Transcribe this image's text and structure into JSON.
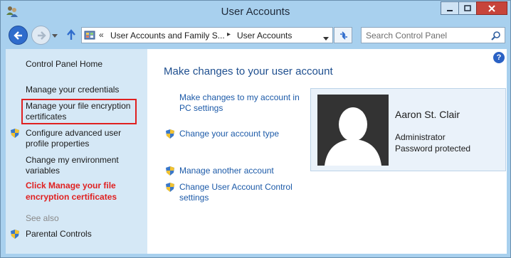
{
  "window": {
    "title": "User Accounts"
  },
  "navigation": {
    "breadcrumbs": [
      "User Accounts and Family S...",
      "User Accounts"
    ],
    "overflow_glyph": "«",
    "search_placeholder": "Search Control Panel"
  },
  "sidebar": {
    "home": "Control Panel Home",
    "links": [
      "Manage your credentials",
      "Manage your file encryption certificates",
      "Configure advanced user profile properties",
      "Change my environment variables"
    ],
    "see_also_label": "See also",
    "see_also_links": [
      "Parental Controls"
    ]
  },
  "annotation": {
    "callout": "Click Manage your file encryption certificates",
    "color": "#e02020"
  },
  "main": {
    "title": "Make changes to your user account",
    "tasks": [
      "Make changes to my account in PC settings",
      "Change your account type",
      "Manage another account",
      "Change User Account Control settings"
    ],
    "help_label": "?"
  },
  "account": {
    "name": "Aaron St. Clair",
    "type": "Administrator",
    "status": "Password protected"
  },
  "icons": [
    "app-users-icon",
    "minimize-icon",
    "maximize-icon",
    "close-icon",
    "back-arrow-icon",
    "forward-arrow-icon",
    "up-arrow-icon",
    "refresh-icon",
    "search-icon",
    "uac-shield-icon",
    "user-avatar-icon",
    "help-icon"
  ],
  "colors": {
    "link": "#1c5aa8",
    "sidebar_bg": "#d5e8f6",
    "frame": "#a8d0ee",
    "close_button": "#c7443a"
  }
}
